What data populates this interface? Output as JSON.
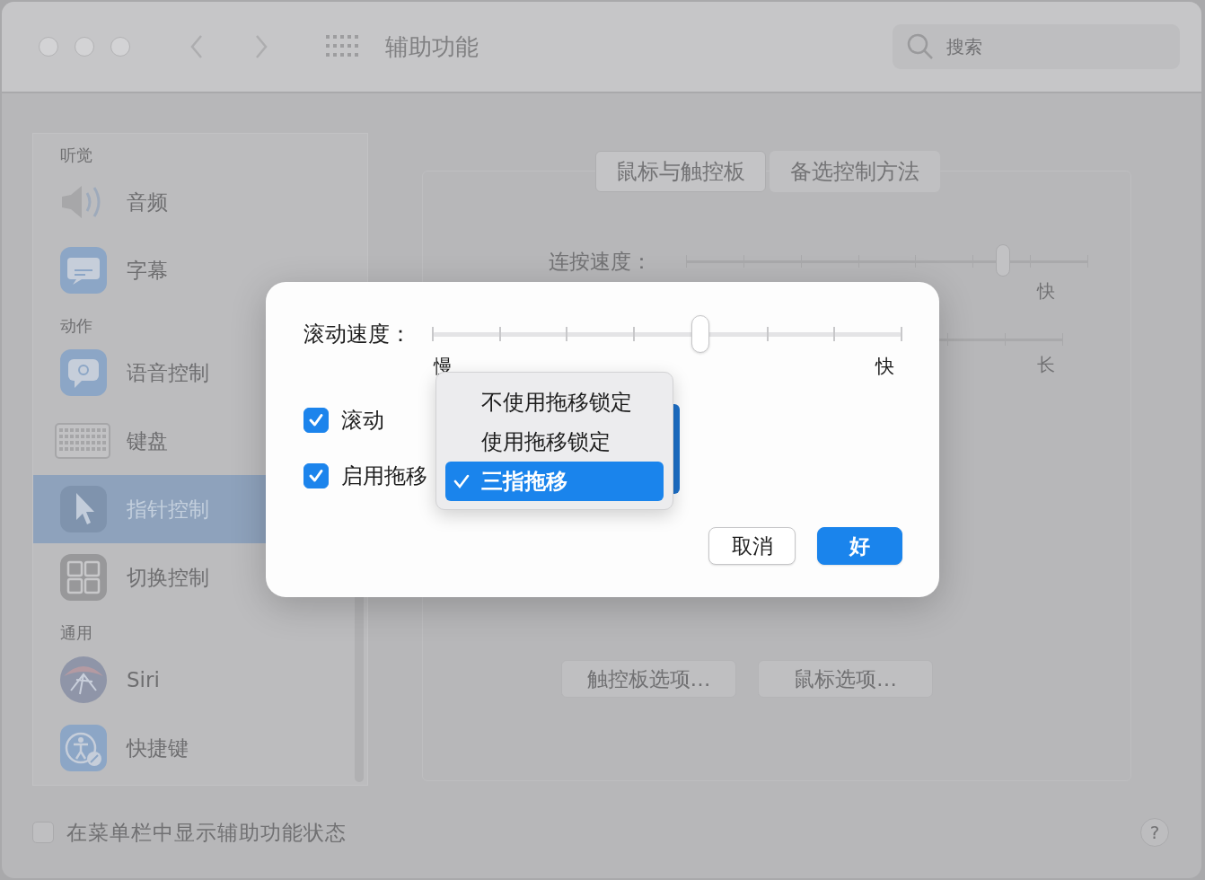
{
  "window": {
    "title": "辅助功能"
  },
  "search": {
    "placeholder": "搜索"
  },
  "sidebar": {
    "groups": [
      {
        "header": "听觉",
        "items": [
          {
            "label": "音频",
            "kind": "speaker",
            "selected": false
          },
          {
            "label": "字幕",
            "kind": "captions",
            "selected": false
          }
        ]
      },
      {
        "header": "动作",
        "items": [
          {
            "label": "语音控制",
            "kind": "voice",
            "selected": false
          },
          {
            "label": "键盘",
            "kind": "keyboard",
            "selected": false
          },
          {
            "label": "指针控制",
            "kind": "pointer",
            "selected": true
          },
          {
            "label": "切换控制",
            "kind": "switch",
            "selected": false
          }
        ]
      },
      {
        "header": "通用",
        "items": [
          {
            "label": "Siri",
            "kind": "siri",
            "selected": false
          },
          {
            "label": "快捷键",
            "kind": "shortcut",
            "selected": false
          }
        ]
      }
    ]
  },
  "tabs": [
    {
      "label": "鼠标与触控板",
      "selected": true
    },
    {
      "label": "备选控制方法",
      "selected": false
    }
  ],
  "double_click_speed": {
    "label": "连按速度：",
    "level": 0.79,
    "max_label": "快"
  },
  "spring_delay": {
    "max_label": "长"
  },
  "option_buttons": [
    "触控板选项…",
    "鼠标选项…"
  ],
  "show_status": {
    "label": "在菜单栏中显示辅助功能状态",
    "checked": false
  },
  "help_button": {
    "label": "?"
  },
  "dialog": {
    "scroll_speed": {
      "label": "滚动速度：",
      "level": 0.57,
      "min_label": "慢",
      "max_label": "快"
    },
    "checkboxes": [
      {
        "label": "滚动",
        "checked": true
      },
      {
        "label": "启用拖移",
        "checked": true
      }
    ],
    "menu": [
      {
        "label": "不使用拖移锁定",
        "selected": false
      },
      {
        "label": "使用拖移锁定",
        "selected": false
      },
      {
        "label": "三指拖移",
        "selected": true
      }
    ],
    "buttons": [
      {
        "label": "取消",
        "kind": "secondary"
      },
      {
        "label": "好",
        "kind": "primary"
      }
    ]
  }
}
